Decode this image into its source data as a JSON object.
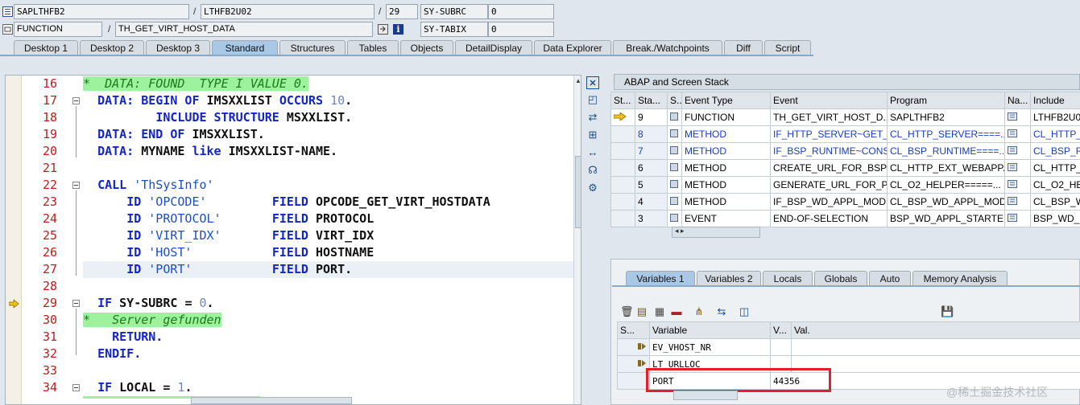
{
  "header": {
    "row1": {
      "program": "SAPLTHFB2",
      "include": "LTHFB2U02",
      "line": "29",
      "sys_field": "SY-SUBRC",
      "sys_value": "0"
    },
    "row2": {
      "type": "FUNCTION",
      "name": "TH_GET_VIRT_HOST_DATA",
      "sys_field": "SY-TABIX",
      "sys_value": "0"
    },
    "slash": "/"
  },
  "tabs": [
    "Desktop 1",
    "Desktop 2",
    "Desktop 3",
    "Standard",
    "Structures",
    "Tables",
    "Objects",
    "DetailDisplay",
    "Data Explorer",
    "Break./Watchpoints",
    "Diff",
    "Script"
  ],
  "active_tab": "Standard",
  "code": {
    "lines": [
      {
        "n": "16"
      },
      {
        "n": "17"
      },
      {
        "n": "18"
      },
      {
        "n": "19"
      },
      {
        "n": "20"
      },
      {
        "n": "21"
      },
      {
        "n": "22"
      },
      {
        "n": "23"
      },
      {
        "n": "24"
      },
      {
        "n": "25"
      },
      {
        "n": "26"
      },
      {
        "n": "27"
      },
      {
        "n": "28"
      },
      {
        "n": "29"
      },
      {
        "n": "30"
      },
      {
        "n": "31"
      },
      {
        "n": "32"
      },
      {
        "n": "33"
      },
      {
        "n": "34"
      }
    ],
    "t16": "*  DATA: FOUND  TYPE I VALUE 0.",
    "t17a": "DATA:",
    "t17b": "BEGIN OF",
    "t17c": "IMSXXLIST",
    "t17d": "OCCURS",
    "t17e": "10",
    "t17f": ".",
    "t18a": "INCLUDE STRUCTURE",
    "t18b": "MSXXLIST.",
    "t19a": "DATA:",
    "t19b": "END OF",
    "t19c": "IMSXXLIST.",
    "t20a": "DATA:",
    "t20b": "MYNAME",
    "t20c": "like",
    "t20d": "IMSXXLIST-NAME.",
    "t22a": "CALL",
    "t22b": "'ThSysInfo'",
    "t23a": "ID",
    "t23b": "'OPCODE'",
    "t23c": "FIELD",
    "t23d": "OPCODE_GET_VIRT_HOSTDATA",
    "t24a": "ID",
    "t24b": "'PROTOCOL'",
    "t24c": "FIELD",
    "t24d": "PROTOCOL",
    "t25a": "ID",
    "t25b": "'VIRT_IDX'",
    "t25c": "FIELD",
    "t25d": "VIRT_IDX",
    "t26a": "ID",
    "t26b": "'HOST'",
    "t26c": "FIELD",
    "t26d": "HOSTNAME",
    "t27a": "ID",
    "t27b": "'PORT'",
    "t27c": "FIELD",
    "t27d": "PORT.",
    "t29a": "IF",
    "t29b": "SY-SUBRC",
    "t29c": "=",
    "t29d": "0",
    "t29e": ".",
    "t30": "*   Server gefunden",
    "t31": "RETURN.",
    "t32": "ENDIF.",
    "t34a": "IF",
    "t34b": "LOCAL",
    "t34c": "=",
    "t34d": "1",
    "t34e": "."
  },
  "stack": {
    "title": "ABAP and Screen Stack",
    "columns": [
      "St...",
      "Sta...",
      "S...",
      "Event Type",
      "Event",
      "Program",
      "Na...",
      "Include"
    ],
    "rows": [
      {
        "level": "9",
        "type": "FUNCTION",
        "event": "TH_GET_VIRT_HOST_D...",
        "program": "SAPLTHFB2",
        "include": "LTHFB2U0"
      },
      {
        "level": "8",
        "type": "METHOD",
        "event": "IF_HTTP_SERVER~GET_...",
        "program": "CL_HTTP_SERVER====...",
        "include": "CL_HTTP_..."
      },
      {
        "level": "7",
        "type": "METHOD",
        "event": "IF_BSP_RUNTIME~CONS...",
        "program": "CL_BSP_RUNTIME====...",
        "include": "CL_BSP_RU"
      },
      {
        "level": "6",
        "type": "METHOD",
        "event": "CREATE_URL_FOR_BSP_...",
        "program": "CL_HTTP_EXT_WEBAPP...",
        "include": "CL_HTTP_..."
      },
      {
        "level": "5",
        "type": "METHOD",
        "event": "GENERATE_URL_FOR_P...",
        "program": "CL_O2_HELPER=====...",
        "include": "CL_O2_HEL"
      },
      {
        "level": "4",
        "type": "METHOD",
        "event": "IF_BSP_WD_APPL_MOD...",
        "program": "CL_BSP_WD_APPL_MOD...",
        "include": "CL_BSP_W"
      },
      {
        "level": "3",
        "type": "EVENT",
        "event": "END-OF-SELECTION",
        "program": "BSP_WD_APPL_STARTER",
        "include": "BSP_WD_..."
      }
    ]
  },
  "var_tabs": [
    "Variables 1",
    "Variables 2",
    "Locals",
    "Globals",
    "Auto",
    "Memory Analysis"
  ],
  "variables": {
    "columns": [
      "S...",
      "Variable",
      "V...",
      "Val."
    ],
    "rows": [
      {
        "name": "EV_VHOST_NR",
        "value": ""
      },
      {
        "name": "LT_URLLOC",
        "value": ""
      },
      {
        "name": "PORT",
        "value": "44356"
      }
    ]
  },
  "watermark": "@稀土掘金技术社区",
  "colors": {
    "active_tab": "#a8c8e6",
    "comment_bg": "#9df29d",
    "keyword": "#1324c8",
    "line_no": "#c21a1a",
    "highlight_box": "#e0202a"
  }
}
